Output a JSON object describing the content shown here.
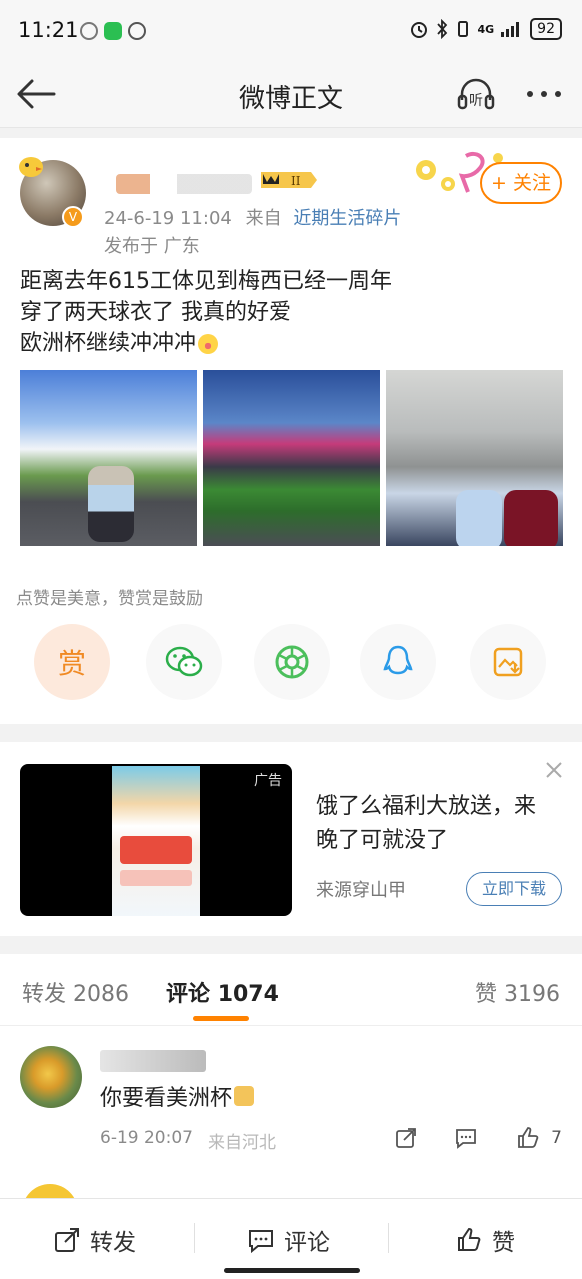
{
  "status_bar": {
    "time": "11:21",
    "network": "4G",
    "battery": "92"
  },
  "nav": {
    "title": "微博正文",
    "listen_label": "听"
  },
  "post": {
    "timestamp": "24-6-19 11:04",
    "from_label": "来自",
    "source": "近期生活碎片",
    "location": "发布于 广东",
    "follow_label": "+ 关注",
    "verified_mark": "V",
    "rank_badge": "II",
    "text_lines": [
      "距离去年615工体见到梅西已经一周年",
      "穿了两天球衣了 我真的好爱",
      "欧洲杯继续冲冲冲"
    ],
    "reward_text": "点赞是美意，赞赏是鼓励",
    "reward_button": "赏"
  },
  "ad": {
    "tag": "广告",
    "title": "饿了么福利大放送，来晚了可就没了",
    "source": "来源穿山甲",
    "cta": "立即下载"
  },
  "tabs": [
    {
      "label": "转发",
      "count": "2086"
    },
    {
      "label": "评论",
      "count": "1074"
    },
    {
      "label": "赞",
      "count": "3196"
    }
  ],
  "comment": {
    "text": "你要看美洲杯",
    "time": "6-19 20:07",
    "location": "来自河北",
    "likes": "7"
  },
  "bottom_bar": {
    "repost": "转发",
    "comment": "评论",
    "like": "赞"
  },
  "colors": {
    "accent": "#ff8200",
    "link": "#4a7fb5"
  }
}
